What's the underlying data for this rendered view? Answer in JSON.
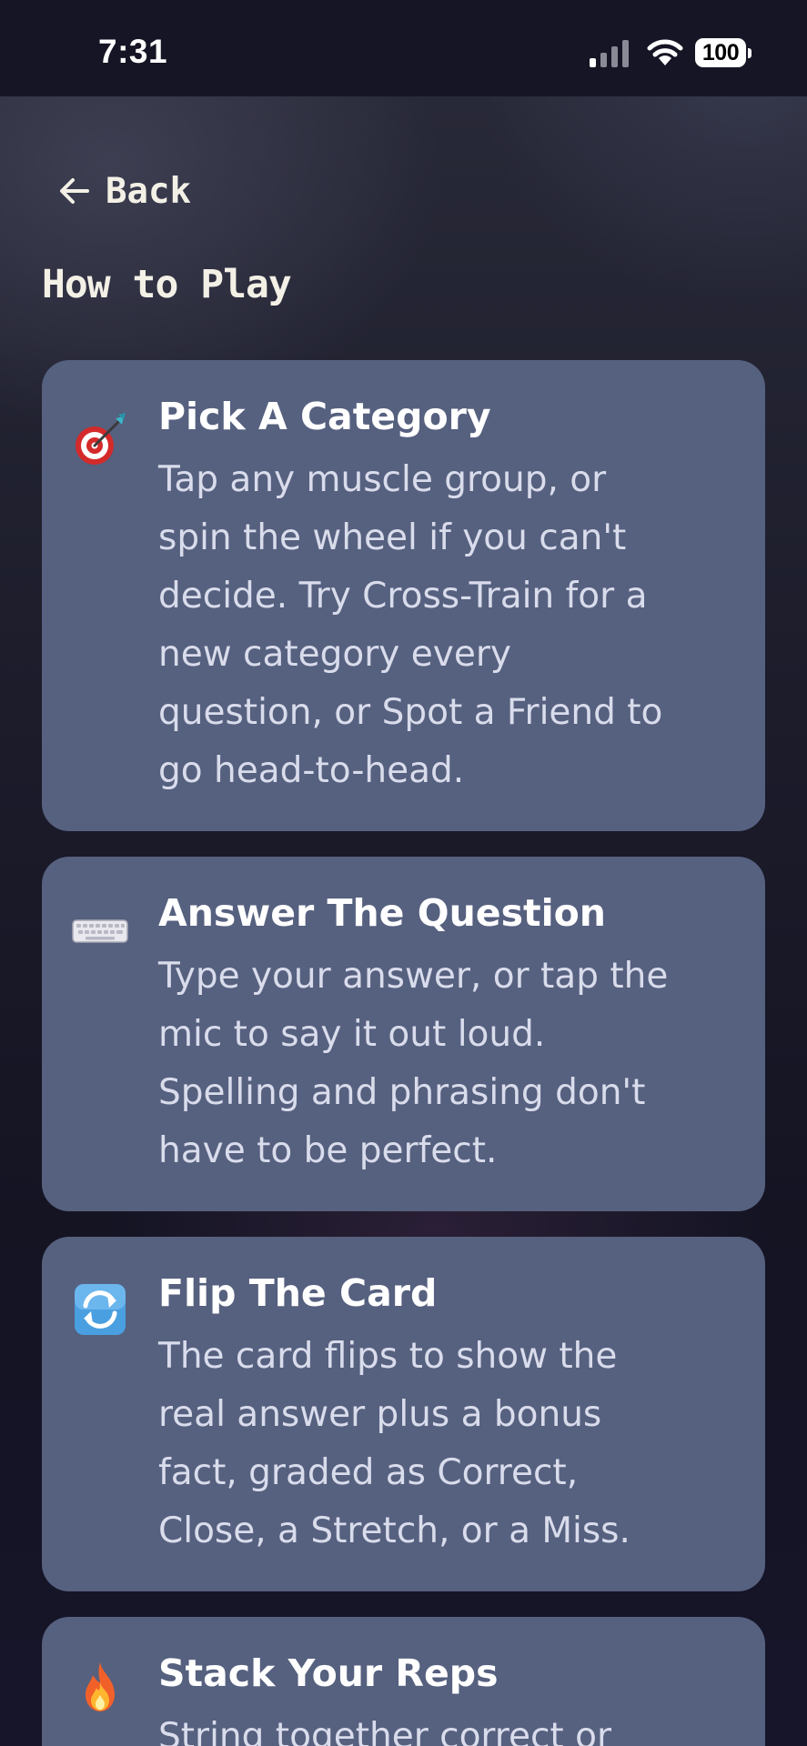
{
  "status_bar": {
    "time": "7:31",
    "battery": "100",
    "icons": [
      "signal-icon",
      "wifi-icon",
      "battery-icon"
    ]
  },
  "nav": {
    "back_label": "Back",
    "back_icon": "arrow-left-icon"
  },
  "page": {
    "title": "How to Play"
  },
  "steps": [
    {
      "icon": "dart-target-icon",
      "title": "Pick A Category",
      "body": "Tap any muscle group, or\nspin the wheel if you can't\ndecide. Try Cross-Train for a\nnew category every\nquestion, or Spot a Friend to\ngo head-to-head."
    },
    {
      "icon": "keyboard-icon",
      "title": "Answer The Question",
      "body": "Type your answer, or tap the\nmic to say it out loud.\nSpelling and phrasing don't\nhave to be perfect."
    },
    {
      "icon": "flip-arrows-icon",
      "title": "Flip The Card",
      "body": "The card flips to show the\nreal answer plus a bonus\nfact, graded as Correct,\nClose, a Stretch, or a Miss."
    },
    {
      "icon": "fire-icon",
      "title": "Stack Your Reps",
      "body": "String together correct or"
    }
  ],
  "colors": {
    "card_background": "#56607f",
    "title_text": "#f3f0e6",
    "body_text": "#d9dceb"
  }
}
